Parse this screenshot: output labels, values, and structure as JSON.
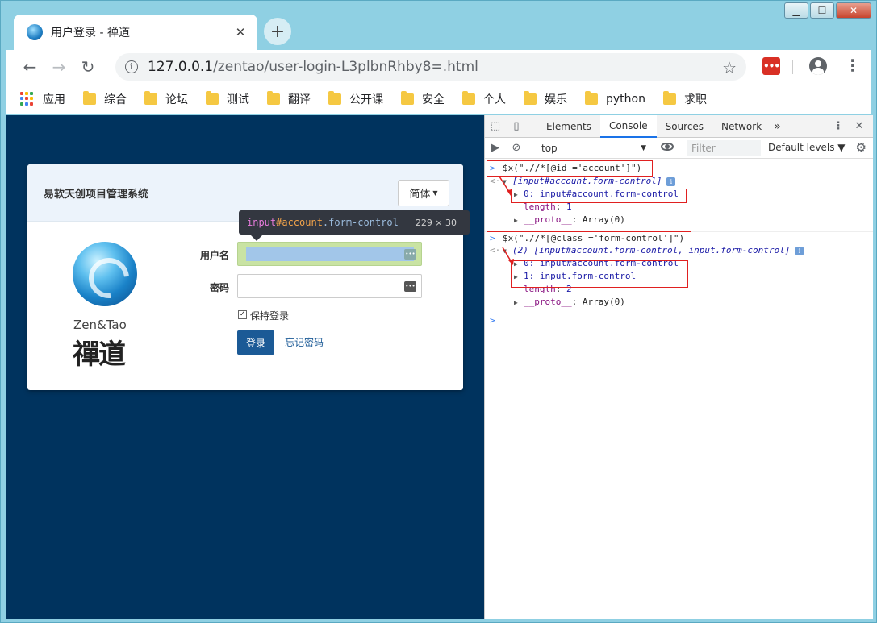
{
  "browser": {
    "tab_title": "用户登录 - 禅道",
    "tab_close": "✕",
    "new_tab": "+",
    "url_host": "127.0.0.1",
    "url_path": "/zentao/user-login-L3plbnRhby8=.html",
    "bookmarks": [
      {
        "label": "应用",
        "icon": "apps-icon"
      },
      {
        "label": "综合",
        "icon": "folder-icon"
      },
      {
        "label": "论坛",
        "icon": "folder-icon"
      },
      {
        "label": "测试",
        "icon": "folder-icon"
      },
      {
        "label": "翻译",
        "icon": "folder-icon"
      },
      {
        "label": "公开课",
        "icon": "folder-icon"
      },
      {
        "label": "安全",
        "icon": "folder-icon"
      },
      {
        "label": "个人",
        "icon": "folder-icon"
      },
      {
        "label": "娱乐",
        "icon": "folder-icon"
      },
      {
        "label": "python",
        "icon": "folder-icon"
      },
      {
        "label": "求职",
        "icon": "folder-icon"
      }
    ]
  },
  "login": {
    "system_title": "易软天创项目管理系统",
    "language_button": "简体",
    "logo_text": "Zen&Tao",
    "logo_mark": "禪道",
    "username_label": "用户名",
    "password_label": "密码",
    "remember_label": "保持登录",
    "login_button": "登录",
    "forget_link": "忘记密码",
    "inspect_tooltip": {
      "tag": "input",
      "id": "#account",
      "cls": ".form-control",
      "dims": "229 × 30"
    }
  },
  "devtools": {
    "tabs": [
      "Elements",
      "Console",
      "Sources",
      "Network"
    ],
    "active_tab": "Console",
    "more_tabs": "»",
    "context": "top",
    "filter_placeholder": "Filter",
    "levels": "Default levels ▼",
    "console": {
      "cmd1": "$x(\".//*[@id ='account']\")",
      "res1_summary": "[input#account.form-control]",
      "res1_item0": "0: input#account.form-control",
      "res1_length_key": "length",
      "res1_length_val": "1",
      "res1_proto_key": "__proto__",
      "res1_proto_val": ": Array(0)",
      "cmd2": "$x(\".//*[@class ='form-control']\")",
      "res2_summary": "(2) [input#account.form-control, input.form-control]",
      "res2_item0": "0: input#account.form-control",
      "res2_item1": "1: input.form-control",
      "res2_length_key": "length",
      "res2_length_val": "2",
      "res2_proto_key": "__proto__",
      "res2_proto_val": ": Array(0)"
    }
  },
  "colors": {
    "page_bg": "#00335e",
    "login_button": "#1b5a96",
    "highlight_box": "#e02020"
  }
}
